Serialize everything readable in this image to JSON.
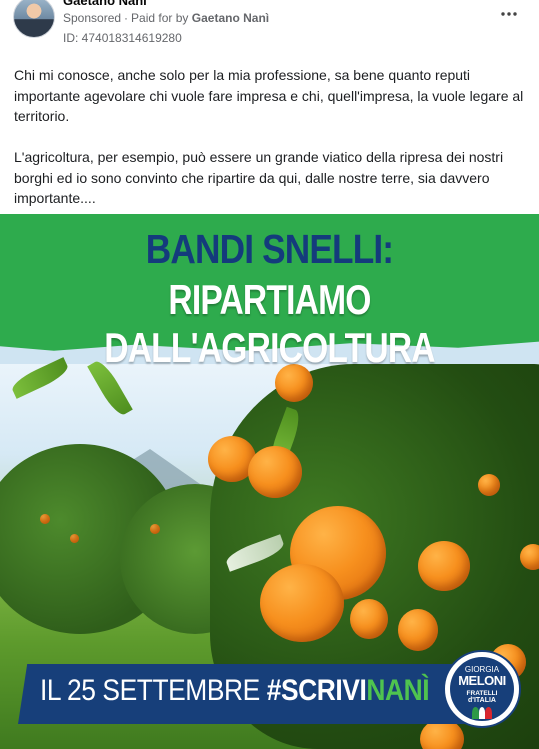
{
  "post": {
    "author_name": "Gaetano Nanì",
    "sponsored_label": "Sponsored",
    "separator": "·",
    "paid_for_label": "Paid for by",
    "payer_name": "Gaetano Nanì",
    "ad_id": "ID: 474018314619280",
    "more_icon": "more-horizontal-icon",
    "paragraph_1": "Chi mi conosce, anche solo per la mia professione, sa bene quanto reputi importante agevolare chi vuole fare impresa e chi, quell'impresa, la vuole legare al territorio.",
    "paragraph_2": "L'agricoltura, per esempio, può essere un grande viatico della ripresa dei nostri borghi ed io sono convinto che ripartire da qui, dalle nostre terre, sia davvero importante...."
  },
  "ad_image": {
    "headline_1": "BANDI SNELLI:",
    "headline_2": "RIPARTIAMO DALL'AGRICOLTURA",
    "cta_prefix": "IL 25 SETTEMBRE ",
    "cta_hashtag": "#SCRIVI",
    "cta_accent": "NANÌ",
    "logo_top": "GIORGIA",
    "logo_name": "MELONI",
    "logo_sub1": "FRATELLI",
    "logo_sub2": "d'ITALIA",
    "colors": {
      "green_band": "#2eab4d",
      "navy": "#173f7a",
      "headline_navy": "#143b7c",
      "accent_green": "#4fc34f",
      "orange": "#f7901e"
    }
  }
}
